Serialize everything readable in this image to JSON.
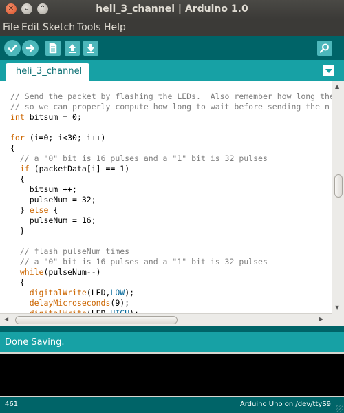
{
  "window": {
    "title": "heli_3_channel | Arduino 1.0",
    "controls": [
      "close-icon",
      "minimize-icon",
      "maximize-icon"
    ]
  },
  "menu": [
    "File",
    "Edit",
    "Sketch",
    "Tools",
    "Help"
  ],
  "toolbar": {
    "buttons": [
      "verify-icon",
      "upload-icon",
      "new-icon",
      "open-icon",
      "save-icon"
    ],
    "right": "serial-monitor-icon"
  },
  "tab": {
    "label": "heli_3_channel"
  },
  "code": [
    [
      {
        "t": "// Send the packet by flashing the LEDs.  Also remember how long the",
        "c": "comment"
      }
    ],
    [
      {
        "t": "// so we can properly compute how long to wait before sending the n",
        "c": "comment"
      }
    ],
    [
      {
        "t": "int",
        "c": "type"
      },
      {
        "t": " bitsum = 0;",
        "c": ""
      }
    ],
    [],
    [
      {
        "t": "for",
        "c": "ctrl"
      },
      {
        "t": " (i=0; i<30; i++)",
        "c": ""
      }
    ],
    [
      {
        "t": "{",
        "c": ""
      }
    ],
    [
      {
        "t": "  // a \"0\" bit is 16 pulses and a \"1\" bit is 32 pulses",
        "c": "comment"
      }
    ],
    [
      {
        "t": "  ",
        "c": ""
      },
      {
        "t": "if",
        "c": "ctrl"
      },
      {
        "t": " (packetData[i] == 1)",
        "c": ""
      }
    ],
    [
      {
        "t": "  {",
        "c": ""
      }
    ],
    [
      {
        "t": "    bitsum ++;",
        "c": ""
      }
    ],
    [
      {
        "t": "    pulseNum = 32;",
        "c": ""
      }
    ],
    [
      {
        "t": "  } ",
        "c": ""
      },
      {
        "t": "else",
        "c": "ctrl"
      },
      {
        "t": " {",
        "c": ""
      }
    ],
    [
      {
        "t": "    pulseNum = 16;",
        "c": ""
      }
    ],
    [
      {
        "t": "  }",
        "c": ""
      }
    ],
    [],
    [
      {
        "t": "  // flash pulseNum times",
        "c": "comment"
      }
    ],
    [
      {
        "t": "  // a \"0\" bit is 16 pulses and a \"1\" bit is 32 pulses",
        "c": "comment"
      }
    ],
    [
      {
        "t": "  ",
        "c": ""
      },
      {
        "t": "while",
        "c": "ctrl"
      },
      {
        "t": "(pulseNum--)",
        "c": ""
      }
    ],
    [
      {
        "t": "  {",
        "c": ""
      }
    ],
    [
      {
        "t": "    ",
        "c": ""
      },
      {
        "t": "digitalWrite",
        "c": "type"
      },
      {
        "t": "(LED,",
        "c": ""
      },
      {
        "t": "LOW",
        "c": "const"
      },
      {
        "t": ");",
        "c": ""
      }
    ],
    [
      {
        "t": "    ",
        "c": ""
      },
      {
        "t": "delayMicroseconds",
        "c": "type"
      },
      {
        "t": "(9);",
        "c": ""
      }
    ],
    [
      {
        "t": "    ",
        "c": ""
      },
      {
        "t": "digitalWrite",
        "c": "type"
      },
      {
        "t": "(LED,",
        "c": ""
      },
      {
        "t": "HIGH",
        "c": "const"
      },
      {
        "t": ");",
        "c": ""
      }
    ]
  ],
  "status": {
    "message": "Done Saving."
  },
  "footer": {
    "line_number": "461",
    "board": "Arduino Uno on /dev/ttyS9"
  },
  "colors": {
    "title_bg": "#3b3a37",
    "toolbar_bg": "#006468",
    "tab_bar_bg": "#17a1a5",
    "button_fill": "#4db7bb",
    "comment": "#7e7e7e",
    "keyword": "#cc6600",
    "constant": "#006699"
  }
}
